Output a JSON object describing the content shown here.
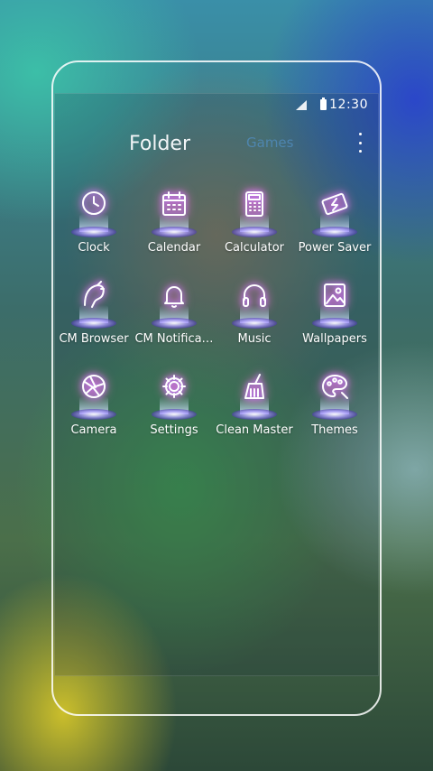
{
  "status_bar": {
    "time": "12:30"
  },
  "header": {
    "tabs": [
      {
        "label": "Folder",
        "active": true
      },
      {
        "label": "Games",
        "active": false
      }
    ]
  },
  "apps": [
    {
      "label": "Clock",
      "icon": "clock-icon"
    },
    {
      "label": "Calendar",
      "icon": "calendar-icon"
    },
    {
      "label": "Calculator",
      "icon": "calculator-icon"
    },
    {
      "label": "Power Saver",
      "icon": "battery-icon"
    },
    {
      "label": "CM Browser",
      "icon": "browser-icon"
    },
    {
      "label": "CM Notifica…",
      "icon": "bell-icon"
    },
    {
      "label": "Music",
      "icon": "headphones-icon"
    },
    {
      "label": "Wallpapers",
      "icon": "picture-icon"
    },
    {
      "label": "Camera",
      "icon": "aperture-icon"
    },
    {
      "label": "Settings",
      "icon": "gear-icon"
    },
    {
      "label": "Clean Master",
      "icon": "broom-icon"
    },
    {
      "label": "Themes",
      "icon": "palette-icon"
    }
  ],
  "colors": {
    "icon_glow": "#b07cff",
    "icon_accent": "#ff6fd8",
    "inactive_tab": "#508cbe"
  }
}
